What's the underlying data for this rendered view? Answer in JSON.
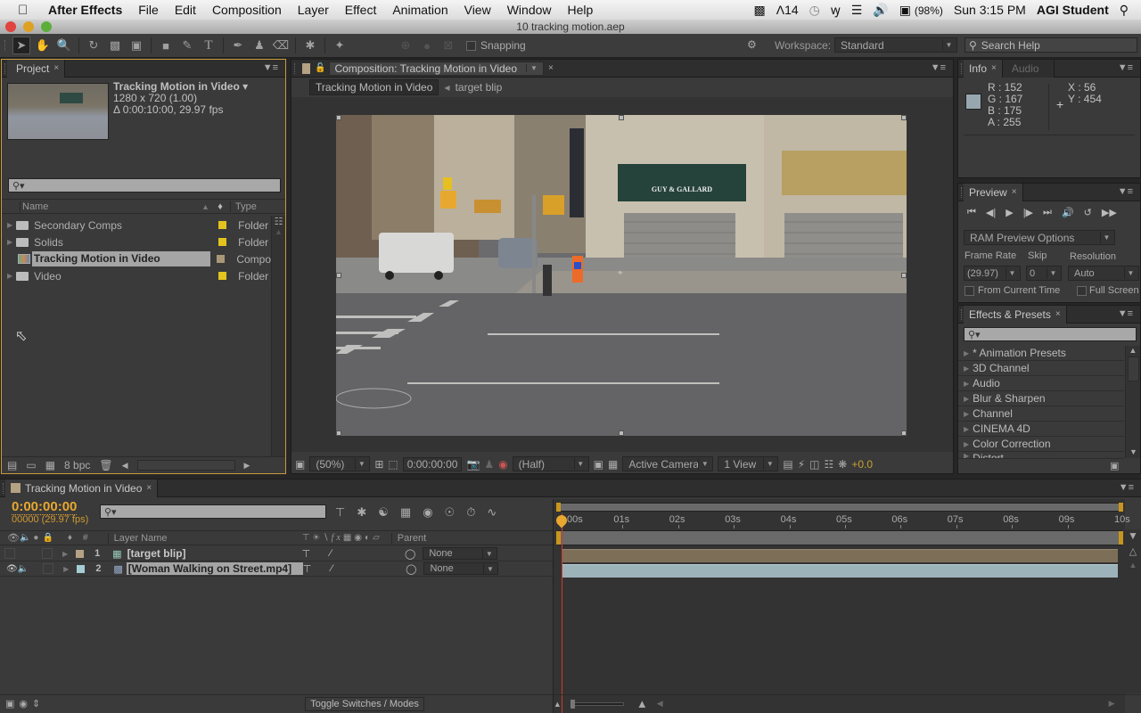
{
  "menubar": {
    "app_name": "After Effects",
    "items": [
      "File",
      "Edit",
      "Composition",
      "Layer",
      "Effect",
      "Animation",
      "View",
      "Window",
      "Help"
    ],
    "status": {
      "adobe_count": "14",
      "battery": "(98%)",
      "clock": "Sun 3:15 PM",
      "user": "AGI Student"
    }
  },
  "window": {
    "title": "10 tracking motion.aep"
  },
  "toolbar": {
    "snapping_label": "Snapping",
    "workspace_label": "Workspace:",
    "workspace_value": "Standard",
    "search_help_placeholder": "Search Help"
  },
  "project": {
    "tab_label": "Project",
    "preview": {
      "name": "Tracking Motion in Video ▾",
      "dimensions": "1280 x 720 (1.00)",
      "duration": "Δ 0:00:10:00, 29.97 fps"
    },
    "columns": {
      "name": "Name",
      "type": "Type"
    },
    "items": [
      {
        "name": "Secondary Comps",
        "type": "Folder",
        "label_color": "#e3c31f",
        "kind": "folder"
      },
      {
        "name": "Solids",
        "type": "Folder",
        "label_color": "#e3c31f",
        "kind": "folder"
      },
      {
        "name": "Tracking Motion in Video",
        "type": "Compo",
        "label_color": "#a89878",
        "kind": "comp",
        "selected": true
      },
      {
        "name": "Video",
        "type": "Folder",
        "label_color": "#e3c31f",
        "kind": "folder"
      }
    ],
    "bpc_label": "8 bpc"
  },
  "composition": {
    "tab_label": "Composition: Tracking Motion in Video",
    "breadcrumbs": [
      "Tracking Motion in Video",
      "target blip"
    ],
    "zoom": "(50%)",
    "timecode": "0:00:00:00",
    "resolution": "(Half)",
    "camera": "Active Camera",
    "views": "1 View",
    "exposure": "+0.0",
    "sign_text": "GUY & GALLARD"
  },
  "info": {
    "tab_label": "Info",
    "audio_tab_label": "Audio",
    "r": "R : 152",
    "g": "G : 167",
    "b": "B : 175",
    "a": "A : 255",
    "x": "X : 56",
    "y": "Y : 454",
    "swatch_color": "#98a7af"
  },
  "preview": {
    "tab_label": "Preview",
    "ram_options": "RAM Preview Options",
    "frame_rate_label": "Frame Rate",
    "skip_label": "Skip",
    "resolution_label": "Resolution",
    "frame_rate_value": "(29.97)",
    "skip_value": "0",
    "resolution_value": "Auto",
    "from_current_time": "From Current Time",
    "full_screen": "Full Screen"
  },
  "effects": {
    "tab_label": "Effects & Presets",
    "items": [
      "* Animation Presets",
      "3D Channel",
      "Audio",
      "Blur & Sharpen",
      "Channel",
      "CINEMA 4D",
      "Color Correction",
      "Distort"
    ]
  },
  "timeline": {
    "tab_label": "Tracking Motion in Video",
    "current_time": "0:00:00:00",
    "frame_info": "00000 (29.97 fps)",
    "columns": {
      "number": "#",
      "layer_name": "Layer Name",
      "parent": "Parent"
    },
    "layers": [
      {
        "number": "1",
        "name": "[target blip]",
        "label_color": "#b5a282",
        "parent": "None",
        "bar_color": "#7d6e58"
      },
      {
        "number": "2",
        "name": "[Woman Walking on Street.mp4]",
        "label_color": "#a5cdd4",
        "parent": "None",
        "bar_color": "#9db3ba",
        "selected": true
      }
    ],
    "ruler": [
      "00s",
      "01s",
      "02s",
      "03s",
      "04s",
      "05s",
      "06s",
      "07s",
      "08s",
      "09s",
      "10s"
    ],
    "toggle_label": "Toggle Switches / Modes"
  }
}
